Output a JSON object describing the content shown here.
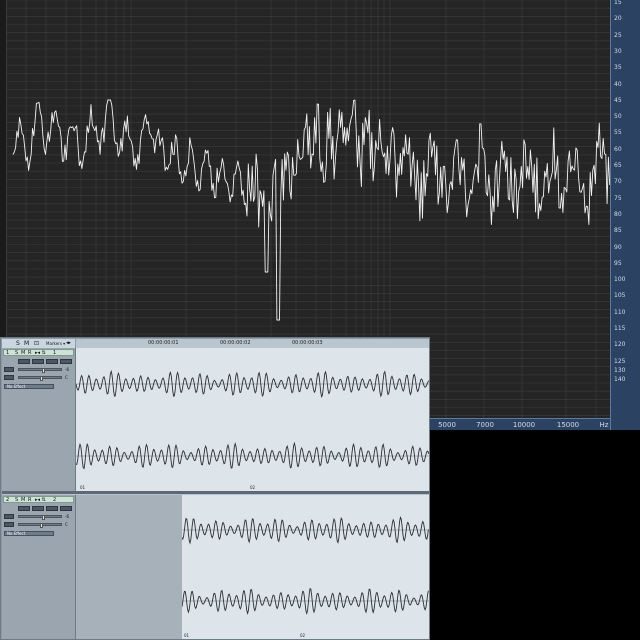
{
  "analyzer": {
    "db_ticks": [
      "15",
      "20",
      "25",
      "30",
      "35",
      "40",
      "45",
      "50",
      "55",
      "60",
      "65",
      "70",
      "75",
      "80",
      "85",
      "90",
      "95",
      "100",
      "105",
      "110",
      "115",
      "120",
      "125",
      "130",
      "140"
    ],
    "freq_ticks": [
      "5000",
      "7000",
      "10000",
      "15000",
      "Hz"
    ],
    "colors": {
      "background": "#252525",
      "grid": "#3c3c3c",
      "trace": "#f2f2f2",
      "scale_bg": "#2b4262"
    }
  },
  "daw": {
    "header": {
      "s": "S",
      "m": "M",
      "loop": "⊡",
      "markers": "Markers ▾",
      "arrows": "◂▸"
    },
    "timeline": {
      "labels": [
        "00:00:00:01",
        "00:00:00:02",
        "00:00:00:03"
      ]
    },
    "tracks": [
      {
        "number": "1",
        "s": "S",
        "m": "M",
        "r": "R",
        "icons": "▸◂ ⇅",
        "name": "1",
        "volume": "-6",
        "pan": "C",
        "insert": "No Effect",
        "markers": [
          "01",
          "02"
        ],
        "vol_percent": 55
      },
      {
        "number": "2",
        "s": "S",
        "m": "M",
        "r": "R",
        "icons": "▸◂ ⇅",
        "name": "2",
        "volume": "-6",
        "pan": "C",
        "insert": "No Effect",
        "markers": [
          "01",
          "02"
        ],
        "vol_percent": 55
      }
    ]
  }
}
